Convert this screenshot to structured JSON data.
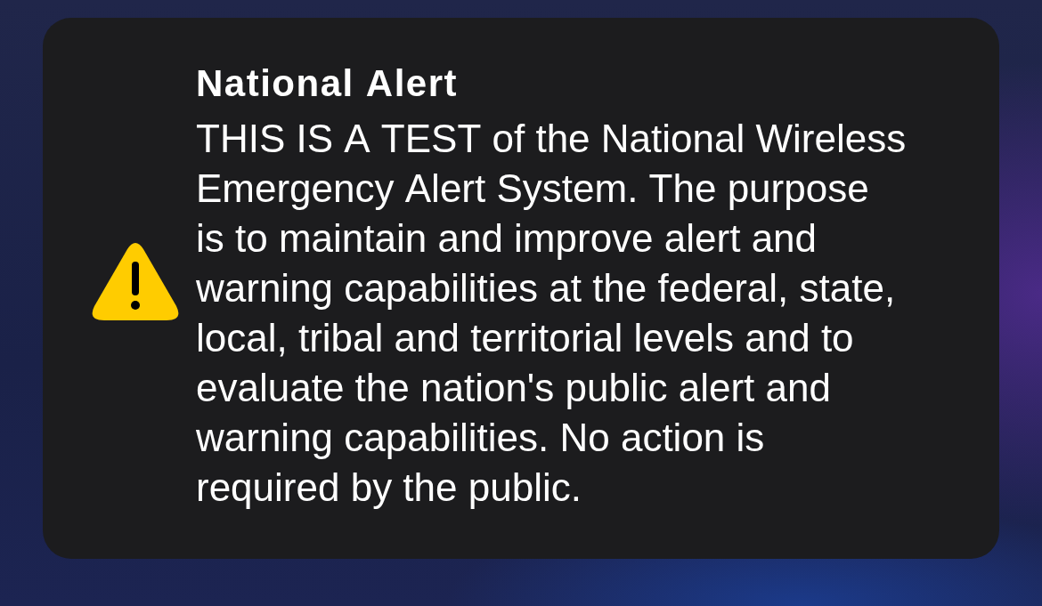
{
  "alert": {
    "title": "National Alert",
    "message": "THIS IS A TEST of the National Wireless Emergency Alert System. The purpose is to maintain and improve alert and warning capabilities at the federal, state, local, tribal and territorial levels and to evaluate the nation's public alert and warning capabilities. No action is required by the public."
  }
}
